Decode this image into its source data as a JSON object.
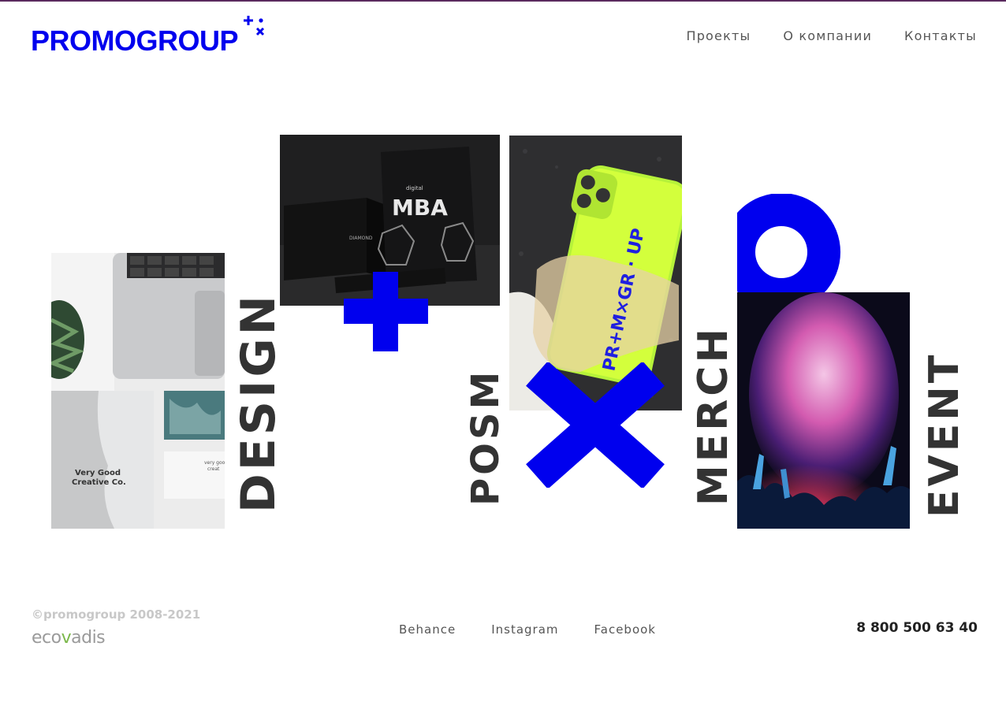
{
  "brand": {
    "logo_text": "PROMOGROUP",
    "color": "#0000ee"
  },
  "nav": {
    "items": [
      {
        "label": "Проекты"
      },
      {
        "label": "О компании"
      },
      {
        "label": "Контакты"
      }
    ]
  },
  "hero": {
    "words": [
      "DESIGN",
      "POSM",
      "MERCH",
      "EVENT"
    ],
    "shapes": [
      "plus-shape",
      "cross-shape",
      "ring-shape"
    ],
    "photos": {
      "stationery": {
        "card_text": "Very Good Creative Co.",
        "card2_text": "very good creat"
      },
      "packaging": {
        "small_label": "digital",
        "big_label": "MBA",
        "box_label": "DIAMOND"
      },
      "phone_case": {
        "case_text": "PR+M×GR · UP"
      }
    }
  },
  "footer": {
    "copyright": "©promogroup 2008-2021",
    "ecovadis": {
      "before": "eco",
      "v": "v",
      "after": "adis"
    },
    "social": [
      {
        "label": "Behance"
      },
      {
        "label": "Instagram"
      },
      {
        "label": "Facebook"
      }
    ],
    "phone": "8 800 500 63 40"
  },
  "colors": {
    "accent": "#0000ee",
    "text": "#333333",
    "muted": "#c8c8c8",
    "ecovadis_green": "#7bb84a"
  }
}
